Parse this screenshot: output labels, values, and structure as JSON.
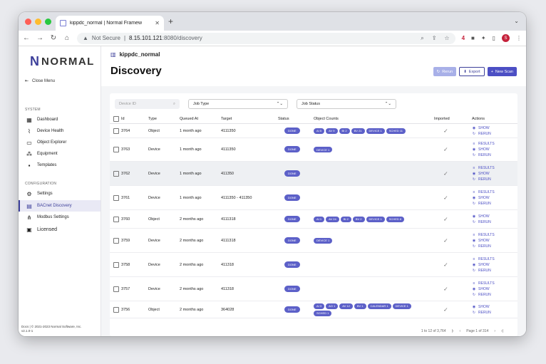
{
  "browser": {
    "tab_title": "kippdc_normal | Normal Framew",
    "url_not_secure": "Not Secure",
    "url_host": "8.15.101.121",
    "url_path": ":8080/discovery",
    "profile_initial": "S"
  },
  "sidebar": {
    "logo": "NORMAL",
    "close_menu": "Close Menu",
    "system_label": "SYSTEM",
    "system_items": [
      {
        "label": "Dashboard"
      },
      {
        "label": "Device Health"
      },
      {
        "label": "Object Explorer"
      },
      {
        "label": "Equipment"
      },
      {
        "label": "Templates"
      }
    ],
    "config_label": "CONFIGURATION",
    "config_items": [
      {
        "label": "Settings"
      },
      {
        "label": "BACnet Discovery"
      },
      {
        "label": "Modbus Settings"
      }
    ],
    "licensed": "Licensed",
    "footer_line1": "Docs | © 2021-2023 Normal Software, Inc.",
    "footer_line2": "v2.1.0-1"
  },
  "header": {
    "breadcrumb": "kippdc_normal",
    "title": "Discovery",
    "rerun": "Rerun",
    "export": "Export",
    "new_scan": "New Scan"
  },
  "filters": {
    "device_id_placeholder": "Device ID",
    "job_type": "Job Type",
    "job_status": "Job Status"
  },
  "table": {
    "headers": [
      "Id",
      "Type",
      "Queued At",
      "Target",
      "Status",
      "Object Counts",
      "Imported",
      "Actions"
    ],
    "rows": [
      {
        "id": "3764",
        "type": "Object",
        "queued": "1 month ago",
        "target": "4111350",
        "status": "DONE",
        "counts": [
          "AI 5",
          "AV 9",
          "BI 2",
          "BV 21",
          "DEVICE 1",
          "SCHED 11"
        ],
        "actions": [
          "SHOW",
          "RERUN"
        ]
      },
      {
        "id": "3763",
        "type": "Device",
        "queued": "1 month ago",
        "target": "4111350",
        "status": "DONE",
        "counts": [
          "DEVICE 1"
        ],
        "actions": [
          "RESULTS",
          "SHOW",
          "RERUN"
        ]
      },
      {
        "id": "3762",
        "type": "Device",
        "queued": "1 month ago",
        "target": "411350",
        "status": "DONE",
        "counts": [],
        "actions": [
          "RESULTS",
          "SHOW",
          "RERUN"
        ]
      },
      {
        "id": "3761",
        "type": "Device",
        "queued": "1 month ago",
        "target": "4111350 - 411350",
        "status": "DONE",
        "counts": [],
        "actions": [
          "RESULTS",
          "SHOW",
          "RERUN"
        ]
      },
      {
        "id": "3760",
        "type": "Object",
        "queued": "2 months ago",
        "target": "4111318",
        "status": "DONE",
        "counts": [
          "AI 1",
          "AV 24",
          "BI 2",
          "BV 2",
          "DEVICE 1",
          "SCHED 8"
        ],
        "actions": [
          "SHOW",
          "RERUN"
        ]
      },
      {
        "id": "3759",
        "type": "Device",
        "queued": "2 months ago",
        "target": "4111318",
        "status": "DONE",
        "counts": [
          "DEVICE 1"
        ],
        "actions": [
          "RESULTS",
          "SHOW",
          "RERUN"
        ]
      },
      {
        "id": "3758",
        "type": "Device",
        "queued": "2 months ago",
        "target": "411318",
        "status": "DONE",
        "counts": [],
        "actions": [
          "RESULTS",
          "SHOW",
          "RERUN"
        ]
      },
      {
        "id": "3757",
        "type": "Device",
        "queued": "2 months ago",
        "target": "411318",
        "status": "DONE",
        "counts": [],
        "actions": [
          "RESULTS",
          "SHOW",
          "RERUN"
        ]
      },
      {
        "id": "3756",
        "type": "Object",
        "queued": "2 months ago",
        "target": "364028",
        "status": "DONE",
        "counts": [
          "AI 3",
          "AO 1",
          "AV 12",
          "BV 1",
          "CALENDAR 1",
          "DEVICE 1",
          "SCHED 1"
        ],
        "actions": [
          "SHOW",
          "RERUN"
        ]
      }
    ]
  },
  "pagination": {
    "range": "1 to 12 of 3,764",
    "page": "Page 1 of 314"
  },
  "colors": {
    "accent": "#4c4fc4",
    "brand": "#3c3f9a"
  }
}
